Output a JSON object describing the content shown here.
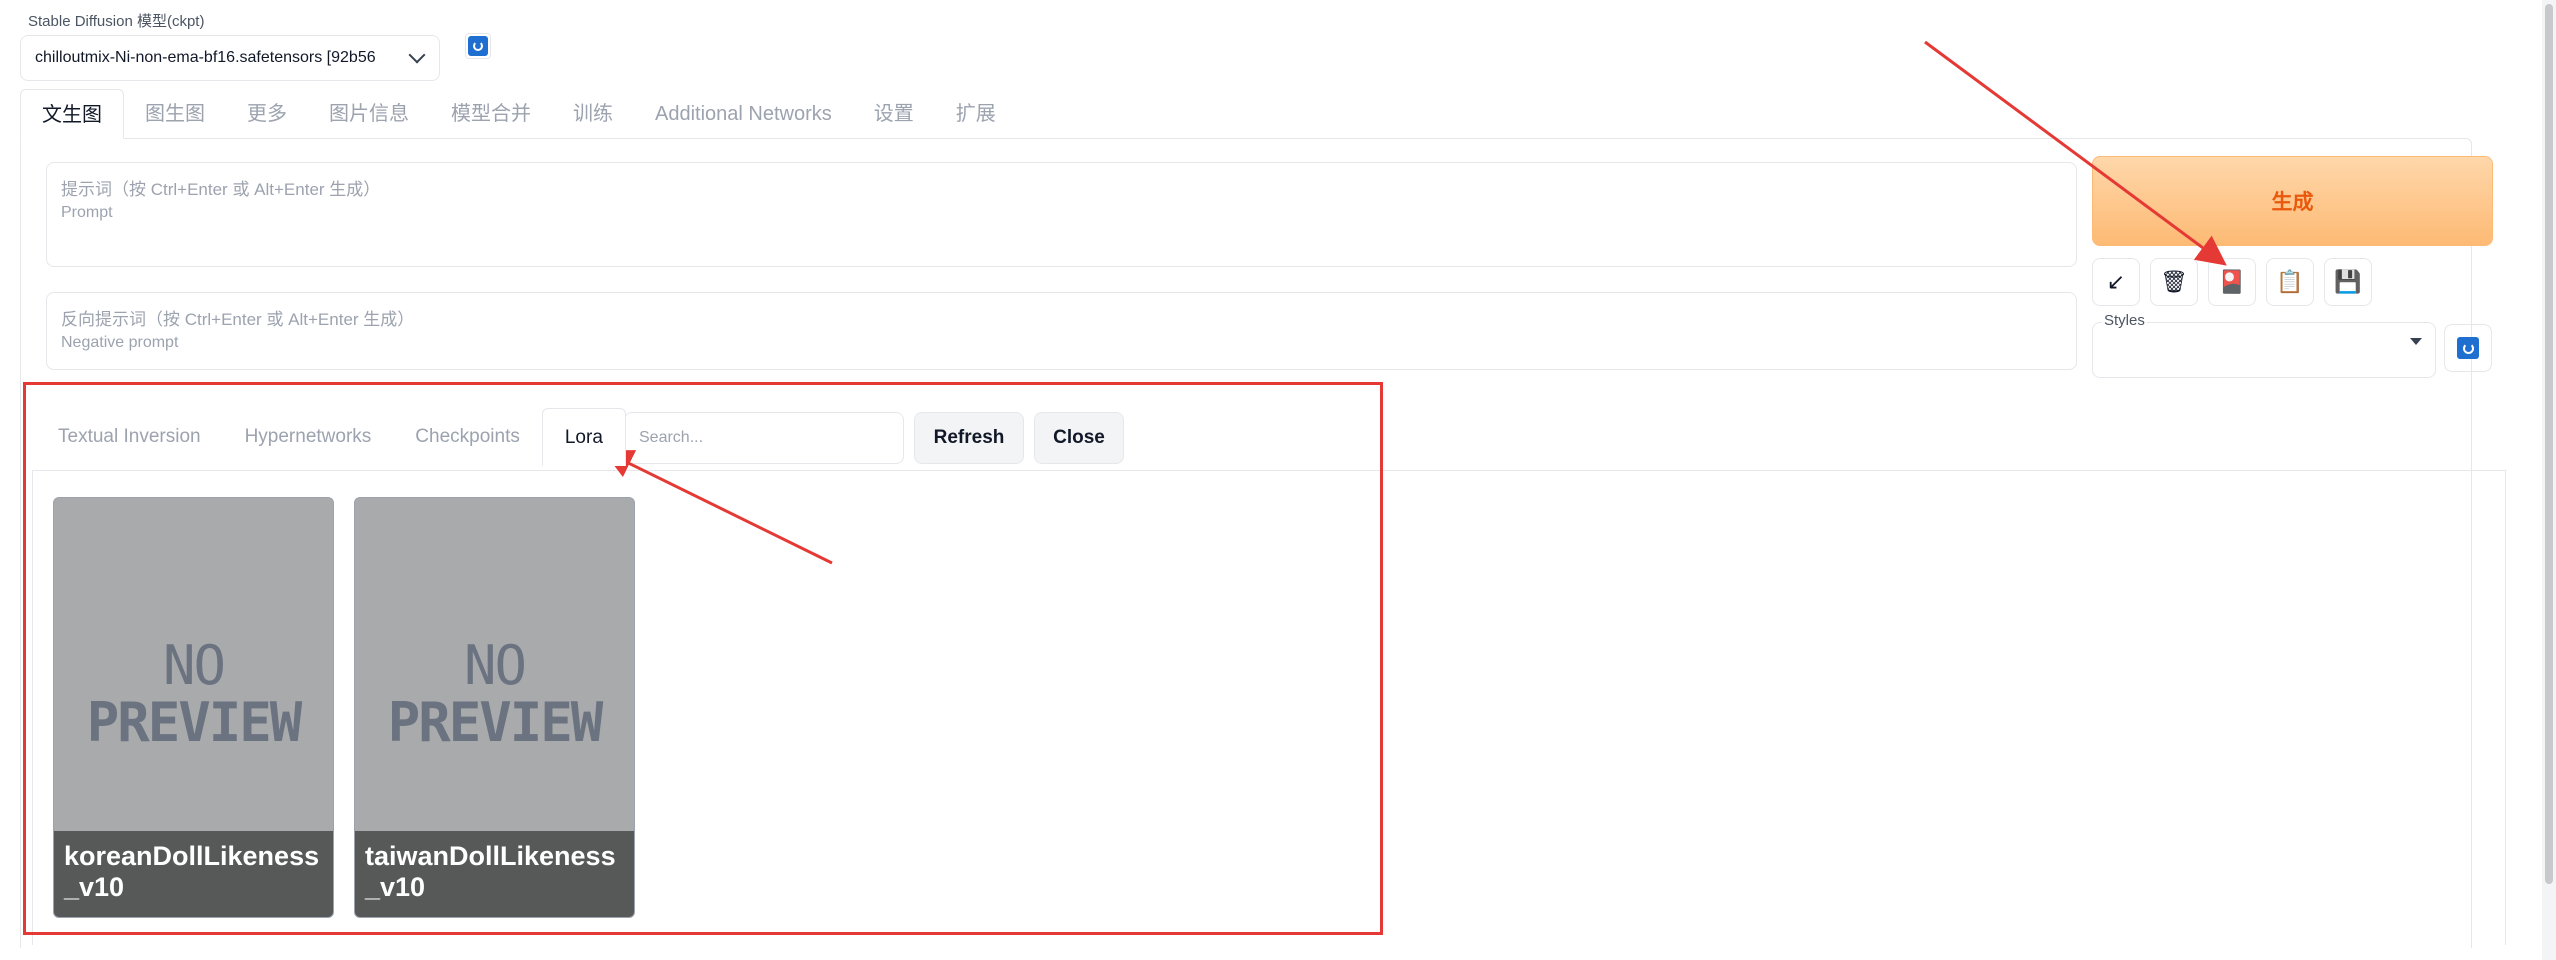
{
  "model": {
    "label": "Stable Diffusion 模型(ckpt)",
    "selected": "chilloutmix-Ni-non-ema-bf16.safetensors [92b56"
  },
  "main_tabs": [
    "文生图",
    "图生图",
    "更多",
    "图片信息",
    "模型合并",
    "训练",
    "Additional Networks",
    "设置",
    "扩展"
  ],
  "prompt": {
    "placeholder_line1": "提示词（按 Ctrl+Enter 或 Alt+Enter 生成）",
    "placeholder_line2": "Prompt"
  },
  "negative_prompt": {
    "placeholder_line1": "反向提示词（按 Ctrl+Enter 或 Alt+Enter 生成）",
    "placeholder_line2": "Negative prompt"
  },
  "generate_label": "生成",
  "tool_icons": [
    "arrow-icon",
    "trash-icon",
    "extra-networks-icon",
    "clipboard-icon",
    "save-icon"
  ],
  "tool_glyphs": [
    "↙",
    "🗑",
    "🎴",
    "📋",
    "💾"
  ],
  "styles_label": "Styles",
  "extra_networks": {
    "tabs": [
      "Textual Inversion",
      "Hypernetworks",
      "Checkpoints",
      "Lora"
    ],
    "active_tab": "Lora",
    "search_placeholder": "Search...",
    "refresh_label": "Refresh",
    "close_label": "Close",
    "cards": [
      {
        "name": "koreanDollLikeness_v10",
        "preview_line1": "NO",
        "preview_line2": "PREVIEW"
      },
      {
        "name": "taiwanDollLikeness_v10",
        "preview_line1": "NO",
        "preview_line2": "PREVIEW"
      }
    ]
  },
  "colors": {
    "accent": "#ea580c",
    "annotation": "#e53935",
    "refresh_blue": "#1f6fd1"
  }
}
